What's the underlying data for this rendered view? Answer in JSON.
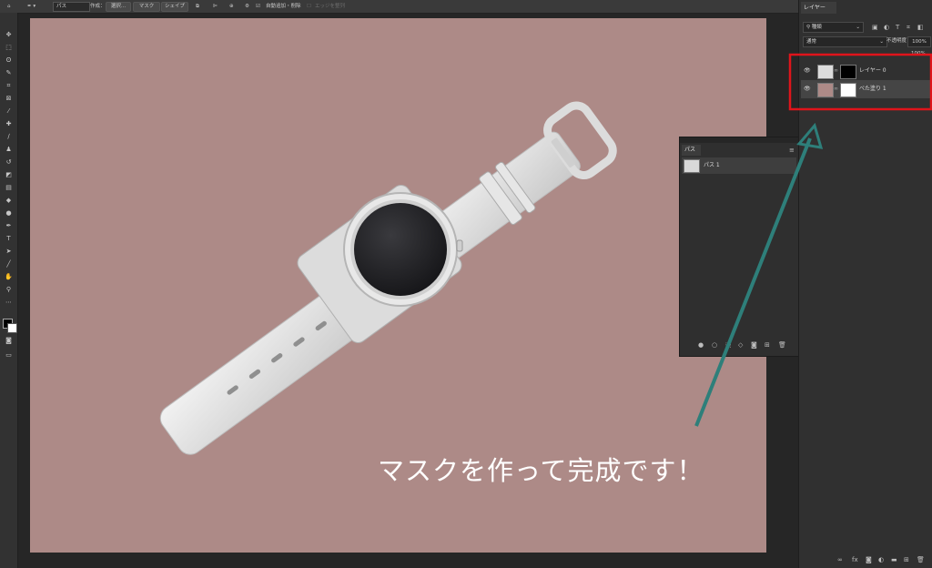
{
  "options_bar": {
    "tool_mode": "パス",
    "make_label": "作成：",
    "select_btn": "選択...",
    "mask_btn": "マスク",
    "shape_btn": "シェイプ",
    "auto_add_delete": "自動追加・削除",
    "align_edges": "エッジを整列"
  },
  "layers_panel": {
    "tab": "レイヤー",
    "filter_kind": "種類",
    "blend_mode": "通常",
    "opacity_label": "不透明度：",
    "opacity_value": "100%",
    "fill_value": "100%",
    "layers": [
      {
        "name": "レイヤー 0"
      },
      {
        "name": "べた塗り 1"
      }
    ]
  },
  "paths_panel": {
    "tab": "パス",
    "paths": [
      {
        "name": "パス 1"
      }
    ]
  },
  "annotation": {
    "text": "マスクを作って完成です！",
    "arrow_color": "#2e7f7a",
    "highlight_color": "#e0141b"
  },
  "colors": {
    "canvas_bg": "#ad8a87",
    "workspace": "#262626"
  }
}
